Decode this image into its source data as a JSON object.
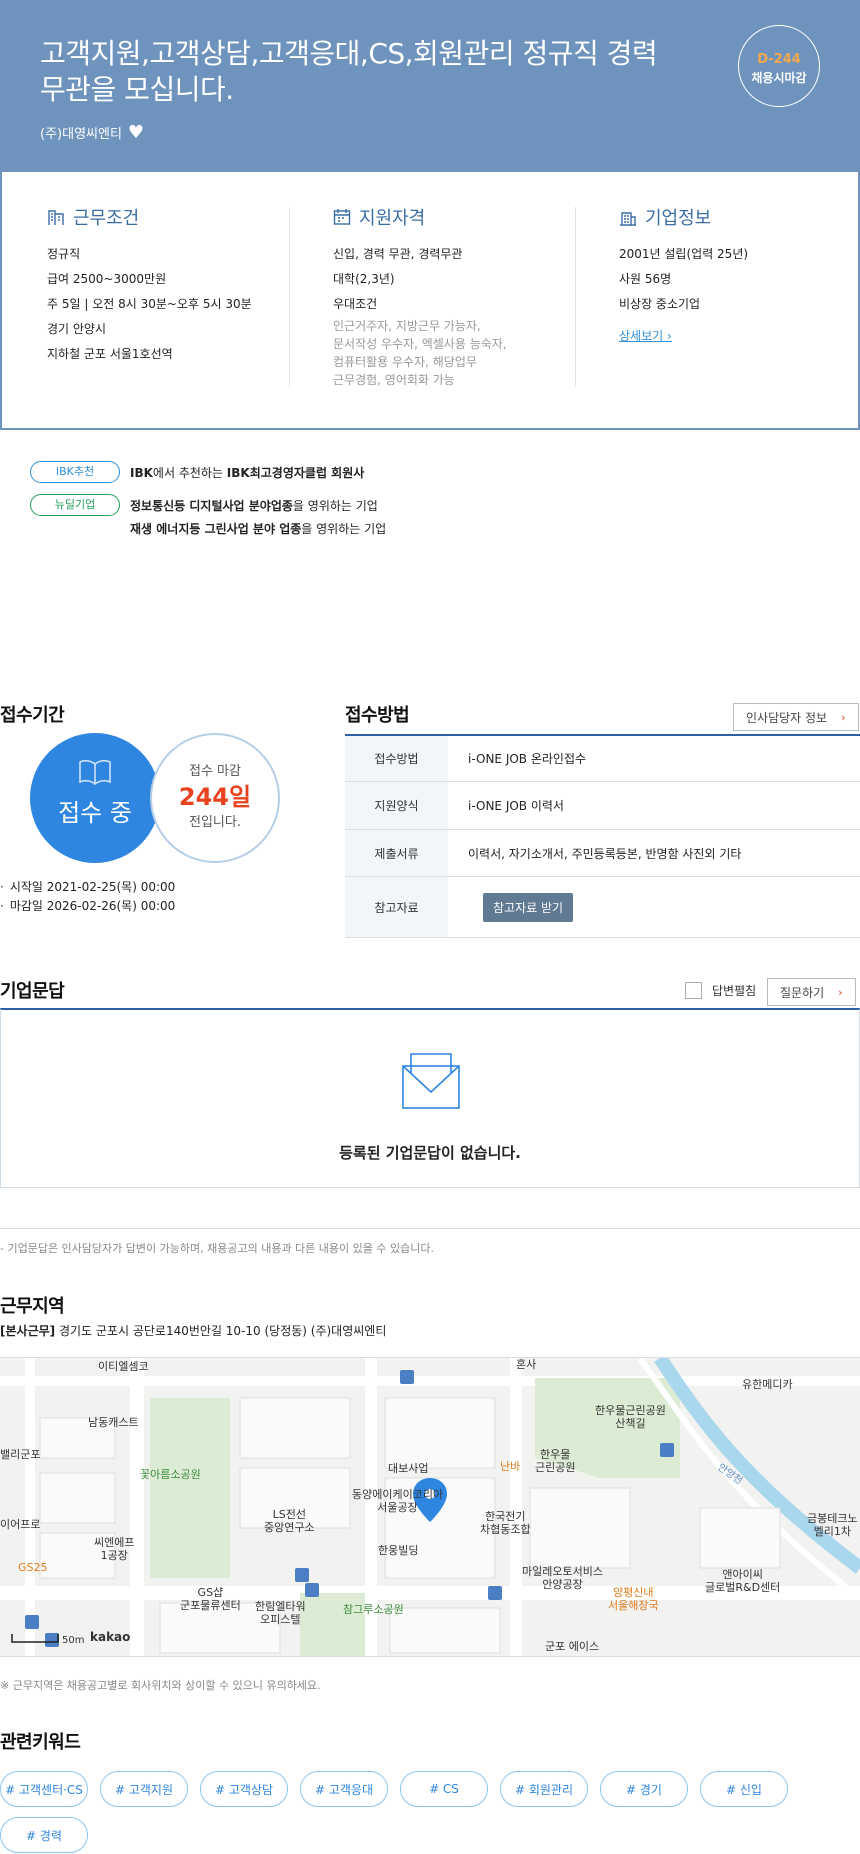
{
  "header": {
    "title": "고객지원,고객상담,고객응대,CS,회원관리 정규직 경력무관을 모십니다.",
    "company": "(주)대영씨엔티",
    "dday": "D-244",
    "deadline_label": "채용시마감",
    "accent_color": "#6e93bd"
  },
  "conditions": {
    "title": "근무조건",
    "items": [
      "정규직",
      "급여 2500~3000만원",
      "주 5일 | 오전 8시 30분~오후 5시 30분",
      "경기 안양시",
      "지하철 군포 서울1호선역"
    ]
  },
  "qualifications": {
    "title": "지원자격",
    "items": [
      "신입, 경력 무관, 경력무관",
      "대학(2,3년)"
    ],
    "pref_title": "우대조건",
    "pref_lines": [
      "인근거주자, 지방근무 가능자,",
      "문서작성 우수자, 엑셀사용 능숙자,",
      "컴퓨터활용 우수자, 해당업무",
      "근무경험, 영어회화 가능"
    ]
  },
  "company_info": {
    "title": "기업정보",
    "items": [
      "2001년 설립(업력 25년)",
      "사원 56명",
      "비상장 중소기업"
    ],
    "detail_link": "상세보기"
  },
  "badges": {
    "ibk_label": "IBK추천",
    "ibk_text_a": "IBK",
    "ibk_text_b": "에서 추천하는 ",
    "ibk_text_c": "IBK최고경영자클럽 회원사",
    "deal_label": "뉴딜기업",
    "deal_line1_bold": "정보통신등 디지털사업 분야업종",
    "deal_line1_rest": "을 영위하는 기업",
    "deal_line2_bold": "재생 에너지등 그린사업 분야 업종",
    "deal_line2_rest": "을 영위하는 기업"
  },
  "period": {
    "title": "접수기간",
    "status": "접수 중",
    "deadline_label": "접수 마감",
    "days": "244일",
    "days_suffix": "전입니다.",
    "start": "시작일 2021-02-25(목) 00:00",
    "end": "마감일 2026-02-26(목) 00:00"
  },
  "apply": {
    "title": "접수방법",
    "hr_button": "인사담당자 정보",
    "rows": [
      {
        "label": "접수방법",
        "value": "i-ONE JOB 온라인접수"
      },
      {
        "label": "지원양식",
        "value": "i-ONE JOB 이력서"
      },
      {
        "label": "제출서류",
        "value": "이력서, 자기소개서, 주민등록등본, 반명함 사진외 기타"
      },
      {
        "label": "참고자료",
        "value": "참고자료 받기"
      }
    ]
  },
  "qna": {
    "title": "기업문답",
    "checkbox_label": "답변펼침",
    "ask_button": "질문하기",
    "empty": "등록된 기업문답이 없습니다.",
    "note": "- 기업문답은 인사담당자가 답변이 가능하며, 채용공고의 내용과 다른 내용이 있을 수 있습니다."
  },
  "location": {
    "title": "근무지역",
    "tag": "[본사근무]",
    "address": "경기도 군포시 공단로140번안길 10-10 (당정동) (주)대영씨엔티",
    "note": "※ 근무지역은 채용공고별로 회사위치와 상이할 수 있으니 유의하세요.",
    "map_labels": [
      "이티엘셈코",
      "남동캐스트",
      "밸리군포",
      "꽃아름소공원",
      "이어프로",
      "씨엔에프\n1공장",
      "LS전선\n중앙연구소",
      "GS25",
      "GS샵\n군포물류센터",
      "한림엘타워\n오피스텔",
      "참그루소공원",
      "대보사업",
      "동양에이케이코리아\n서울공장",
      "한웅빌딩",
      "난바",
      "한우물\n근린공원",
      "한국전기\n차협동조합",
      "한우물근린공원\n산책길",
      "유한메디카",
      "마일레오토서비스\n안양공장",
      "양평신내\n서울해장국",
      "앤아이씨\n글로벌R&D센터",
      "금봉테크노\n벨리1차",
      "군포 에이스",
      "안양천",
      "혼사"
    ],
    "scale": "50m",
    "map_brand": "kakao"
  },
  "keywords": {
    "title": "관련키워드",
    "items": [
      "# 고객센터·CS",
      "# 고객지원",
      "# 고객상담",
      "# 고객응대",
      "# CS",
      "# 회원관리",
      "# 경기",
      "# 신입",
      "# 경력"
    ]
  }
}
